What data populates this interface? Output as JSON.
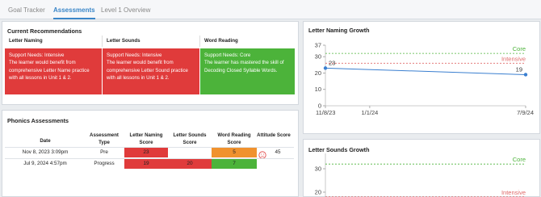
{
  "tabs": [
    {
      "label": "Goal Tracker",
      "active": false
    },
    {
      "label": "Assessments",
      "active": true
    },
    {
      "label": "Level 1 Overview",
      "active": false
    }
  ],
  "recommendations": {
    "title": "Current Recommendations",
    "columns": [
      {
        "header": "Letter Naming",
        "need": "Support Needs: Intensive",
        "text": "The learner would benefit from comprehensive Letter Name practice with all lessons in Unit 1 & 2.",
        "color": "#e03b3b"
      },
      {
        "header": "Letter Sounds",
        "need": "Support Needs: Intensive",
        "text": "The learner would benefit from comprehensive Letter Sound practice with all lessons in Unit 1 & 2.",
        "color": "#e03b3b"
      },
      {
        "header": "Word Reading",
        "need": "Support Needs: Core",
        "text": "The learner has mastered the skill of Decoding Closed Syllable Words.",
        "color": "#4cb33a"
      }
    ]
  },
  "phonics": {
    "title": "Phonics Assessments",
    "headers": [
      "Date",
      "Assessment Type",
      "Letter Naming Score",
      "Letter Sounds Score",
      "Word Reading Score",
      "Attitude Score"
    ],
    "rows": [
      {
        "date": "Nov 8, 2023 3:09pm",
        "type": "Pre",
        "naming": "23",
        "sounds": "",
        "reading": "5",
        "attitude": "45",
        "attitude_icon": "frown-face-icon"
      },
      {
        "date": "Jul 9, 2024 4:57pm",
        "type": "Progress",
        "naming": "19",
        "sounds": "20",
        "reading": "7",
        "attitude": "",
        "attitude_icon": ""
      }
    ],
    "colors": {
      "red": "#e03b3b",
      "orange": "#f0922e",
      "green": "#4cb33a"
    }
  },
  "chart_data": [
    {
      "type": "line",
      "title": "Letter Naming Growth",
      "x_ticks": [
        "11/8/23",
        "1/1/24",
        "7/9/24"
      ],
      "y_ticks": [
        0,
        10,
        20,
        30,
        37
      ],
      "ylim": [
        0,
        37
      ],
      "series": [
        {
          "x": [
            "11/8/23",
            "7/9/24"
          ],
          "values": [
            23,
            19
          ],
          "labels": [
            "23",
            "19"
          ],
          "color": "#3a7fd0"
        }
      ],
      "thresholds": [
        {
          "label": "Core",
          "value": 32,
          "color": "#4cb33a"
        },
        {
          "label": "Intensive",
          "value": 26,
          "color": "#e06a6a"
        }
      ]
    },
    {
      "type": "line",
      "title": "Letter Sounds Growth",
      "y_ticks": [
        20,
        30
      ],
      "series": [],
      "thresholds": [
        {
          "label": "Core",
          "value": 32,
          "color": "#4cb33a"
        },
        {
          "label": "Intensive",
          "value": 18,
          "color": "#e06a6a"
        }
      ]
    }
  ]
}
